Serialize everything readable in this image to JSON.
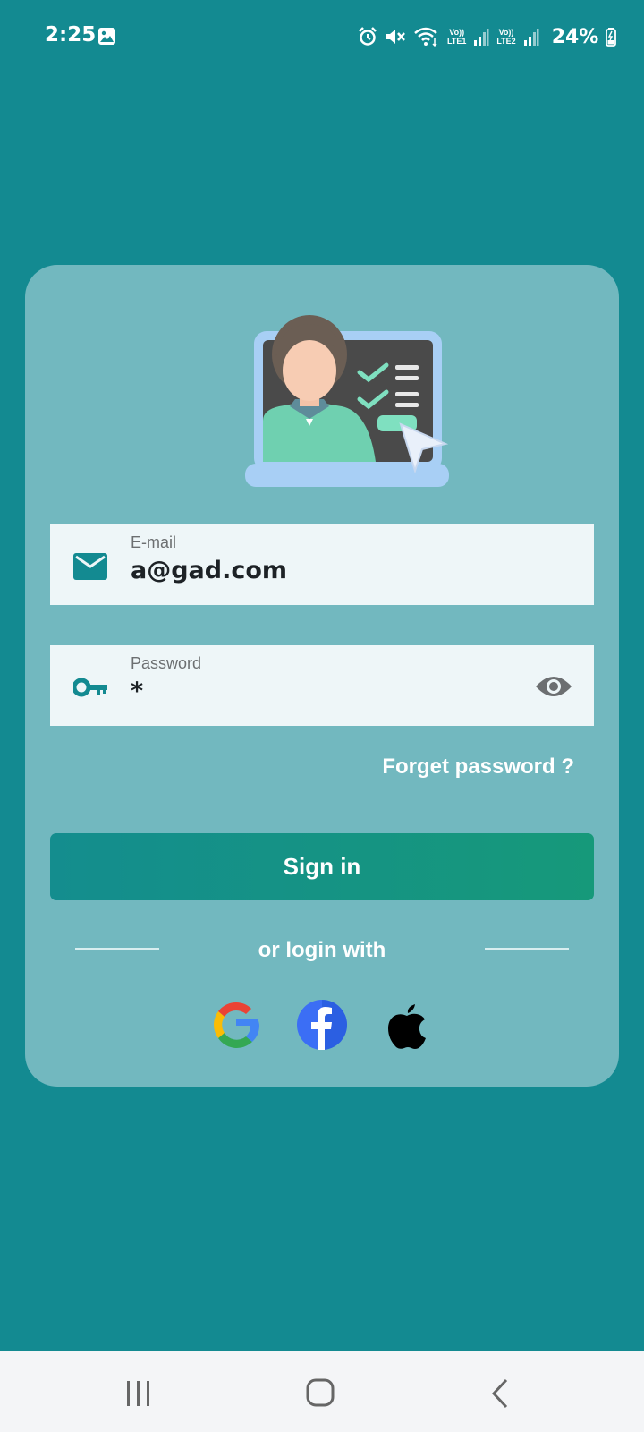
{
  "status_bar": {
    "time": "2:25",
    "sim1_label_top": "Vo))",
    "sim1_label_bottom": "LTE1",
    "sim2_label_top": "Vo))",
    "sim2_label_bottom": "LTE2",
    "battery": "24%",
    "icons": [
      "gallery-icon",
      "alarm-icon",
      "mute-icon",
      "wifi-icon",
      "signal-icon",
      "battery-icon"
    ]
  },
  "login": {
    "email": {
      "label": "E-mail",
      "value": "a@gad.com",
      "icon": "mail-icon"
    },
    "password": {
      "label": "Password",
      "value": "*",
      "icon": "key-icon",
      "toggle_icon": "eye-icon"
    },
    "forgot_label": "Forget password ?",
    "signin_label": "Sign in",
    "or_login_label": "or login with",
    "social": [
      "google-icon",
      "facebook-icon",
      "apple-icon"
    ]
  },
  "colors": {
    "background": "#138a91",
    "card": "#72b8bf",
    "field": "#eef6f8",
    "accent": "#148d8e",
    "button_gradient_end": "#16997a"
  },
  "nav_bar": {
    "buttons": [
      "recents-icon",
      "home-icon",
      "back-icon"
    ]
  }
}
